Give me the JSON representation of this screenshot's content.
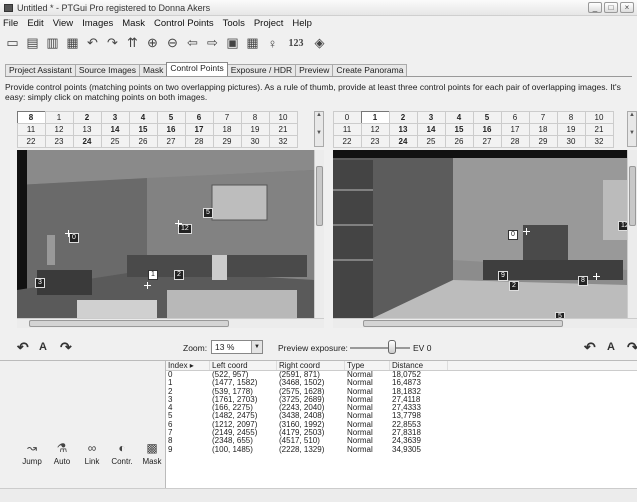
{
  "window": {
    "title": "Untitled * - PTGui Pro registered to Donna Akers",
    "controls": [
      "_",
      "□",
      "×"
    ]
  },
  "menu": [
    "File",
    "Edit",
    "View",
    "Images",
    "Mask",
    "Control Points",
    "Tools",
    "Project",
    "Help"
  ],
  "toolbar": {
    "num_label": "123"
  },
  "tabs": [
    "Project Assistant",
    "Source Images",
    "Mask",
    "Control Points",
    "Exposure / HDR",
    "Preview",
    "Create Panorama"
  ],
  "active_tab": "Control Points",
  "hint": "Provide control points (matching points on two overlapping pictures). As a rule of thumb, provide at least three control points for each pair of overlapping images. It's easy: simply click on matching points on both images.",
  "left_images": {
    "selected": "8",
    "rows": [
      [
        "8",
        "1",
        "2",
        "3",
        "4",
        "5",
        "6",
        "7",
        "8",
        "9",
        "10"
      ],
      [
        "11",
        "12",
        "13",
        "14",
        "15",
        "16",
        "17",
        "18",
        "19",
        "20",
        "21"
      ],
      [
        "22",
        "23",
        "24",
        "25",
        "26",
        "27",
        "28",
        "29",
        "30",
        "31",
        "32"
      ]
    ]
  },
  "right_images": {
    "selected": "1",
    "rows": [
      [
        "0",
        "1",
        "2",
        "3",
        "4",
        "5",
        "6",
        "7",
        "8",
        "9",
        "10"
      ],
      [
        "11",
        "12",
        "13",
        "14",
        "15",
        "16",
        "17",
        "18",
        "19",
        "20",
        "21"
      ],
      [
        "22",
        "23",
        "24",
        "25",
        "26",
        "27",
        "28",
        "29",
        "30",
        "31",
        "32"
      ]
    ]
  },
  "left_points": [
    "0",
    "12",
    "5",
    "1",
    "2",
    "3"
  ],
  "right_points": [
    "0",
    "12",
    "8",
    "9",
    "2",
    "5"
  ],
  "zoom": {
    "label": "Zoom:",
    "value": "13 %"
  },
  "preview": {
    "label": "Preview exposure:",
    "ev": "EV 0"
  },
  "controls_left": [
    "↶",
    "A",
    "↷"
  ],
  "controls_right": [
    "↶",
    "A",
    "↷"
  ],
  "actions": [
    {
      "label": "Jump",
      "icon": "jump-icon"
    },
    {
      "label": "Auto",
      "icon": "auto-icon"
    },
    {
      "label": "Link",
      "icon": "link-icon"
    },
    {
      "label": "Contr.",
      "icon": "contr-icon"
    },
    {
      "label": "Mask",
      "icon": "mask-icon"
    }
  ],
  "table": {
    "headers": [
      "Index ▸",
      "Left coord",
      "Right coord",
      "Type",
      "Distance"
    ],
    "rows": [
      [
        "0",
        "(522, 957)",
        "(2591, 871)",
        "Normal",
        "18,0752"
      ],
      [
        "1",
        "(1477, 1582)",
        "(3468, 1502)",
        "Normal",
        "16,4873"
      ],
      [
        "2",
        "(539, 1778)",
        "(2575, 1628)",
        "Normal",
        "18,1832"
      ],
      [
        "3",
        "(1761, 2703)",
        "(3725, 2689)",
        "Normal",
        "27,4118"
      ],
      [
        "4",
        "(166, 2275)",
        "(2243, 2040)",
        "Normal",
        "27,4333"
      ],
      [
        "5",
        "(1482, 2475)",
        "(3438, 2408)",
        "Normal",
        "13,7798"
      ],
      [
        "6",
        "(1212, 2097)",
        "(3160, 1992)",
        "Normal",
        "22,8553"
      ],
      [
        "7",
        "(2149, 2455)",
        "(4179, 2503)",
        "Normal",
        "27,8318"
      ],
      [
        "8",
        "(2348, 655)",
        "(4517, 510)",
        "Normal",
        "24,3639"
      ],
      [
        "9",
        "(100, 1485)",
        "(2228, 1329)",
        "Normal",
        "34,9305"
      ]
    ]
  }
}
